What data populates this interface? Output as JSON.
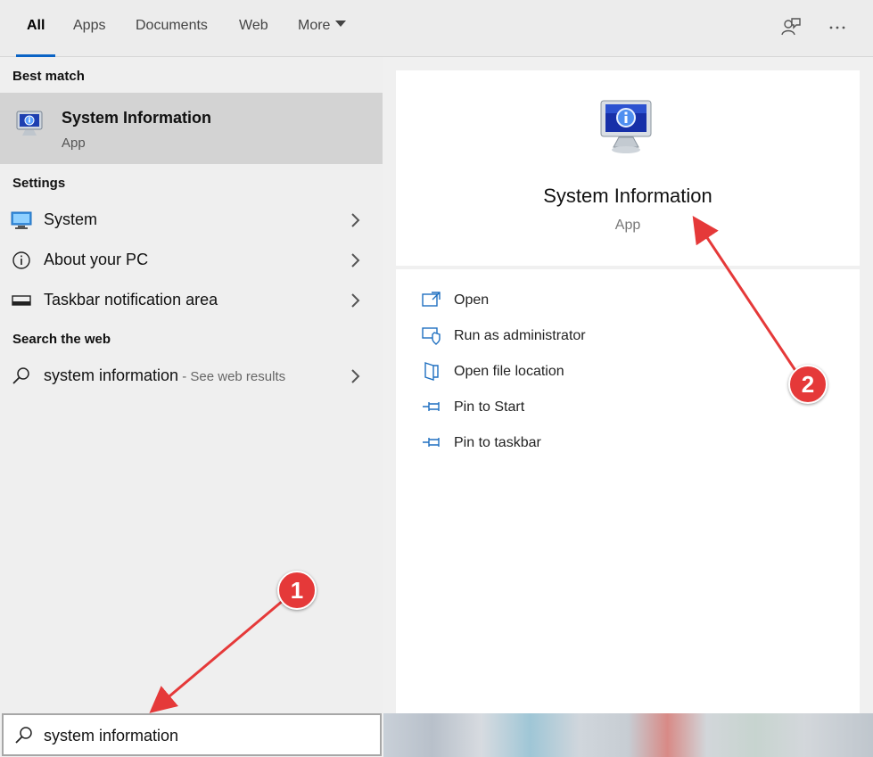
{
  "tabs": [
    {
      "label": "All",
      "active": true
    },
    {
      "label": "Apps"
    },
    {
      "label": "Documents"
    },
    {
      "label": "Web"
    },
    {
      "label": "More"
    }
  ],
  "left": {
    "best_match_heading": "Best match",
    "best_match": {
      "title": "System Information",
      "subtitle": "App",
      "icon": "monitor-info-icon"
    },
    "settings_heading": "Settings",
    "settings": [
      {
        "label": "System",
        "icon": "display-icon"
      },
      {
        "label": "About your PC",
        "icon": "info-icon"
      },
      {
        "label": "Taskbar notification area",
        "icon": "taskbar-icon"
      }
    ],
    "web_heading": "Search the web",
    "web_result": {
      "label": "system information",
      "suffix": " - See web results",
      "icon": "search-icon"
    }
  },
  "right": {
    "title": "System Information",
    "subtitle": "App",
    "actions": [
      {
        "label": "Open",
        "icon": "open-icon"
      },
      {
        "label": "Run as administrator",
        "icon": "shield-icon"
      },
      {
        "label": "Open file location",
        "icon": "folder-icon"
      },
      {
        "label": "Pin to Start",
        "icon": "pin-icon"
      },
      {
        "label": "Pin to taskbar",
        "icon": "pin-icon"
      }
    ]
  },
  "search": {
    "value": "system information"
  },
  "annotations": [
    {
      "label": "1"
    },
    {
      "label": "2"
    }
  ],
  "colors": {
    "accent": "#0a63c5",
    "annotation": "#e53939",
    "icon_blue": "#1e6fc0"
  }
}
